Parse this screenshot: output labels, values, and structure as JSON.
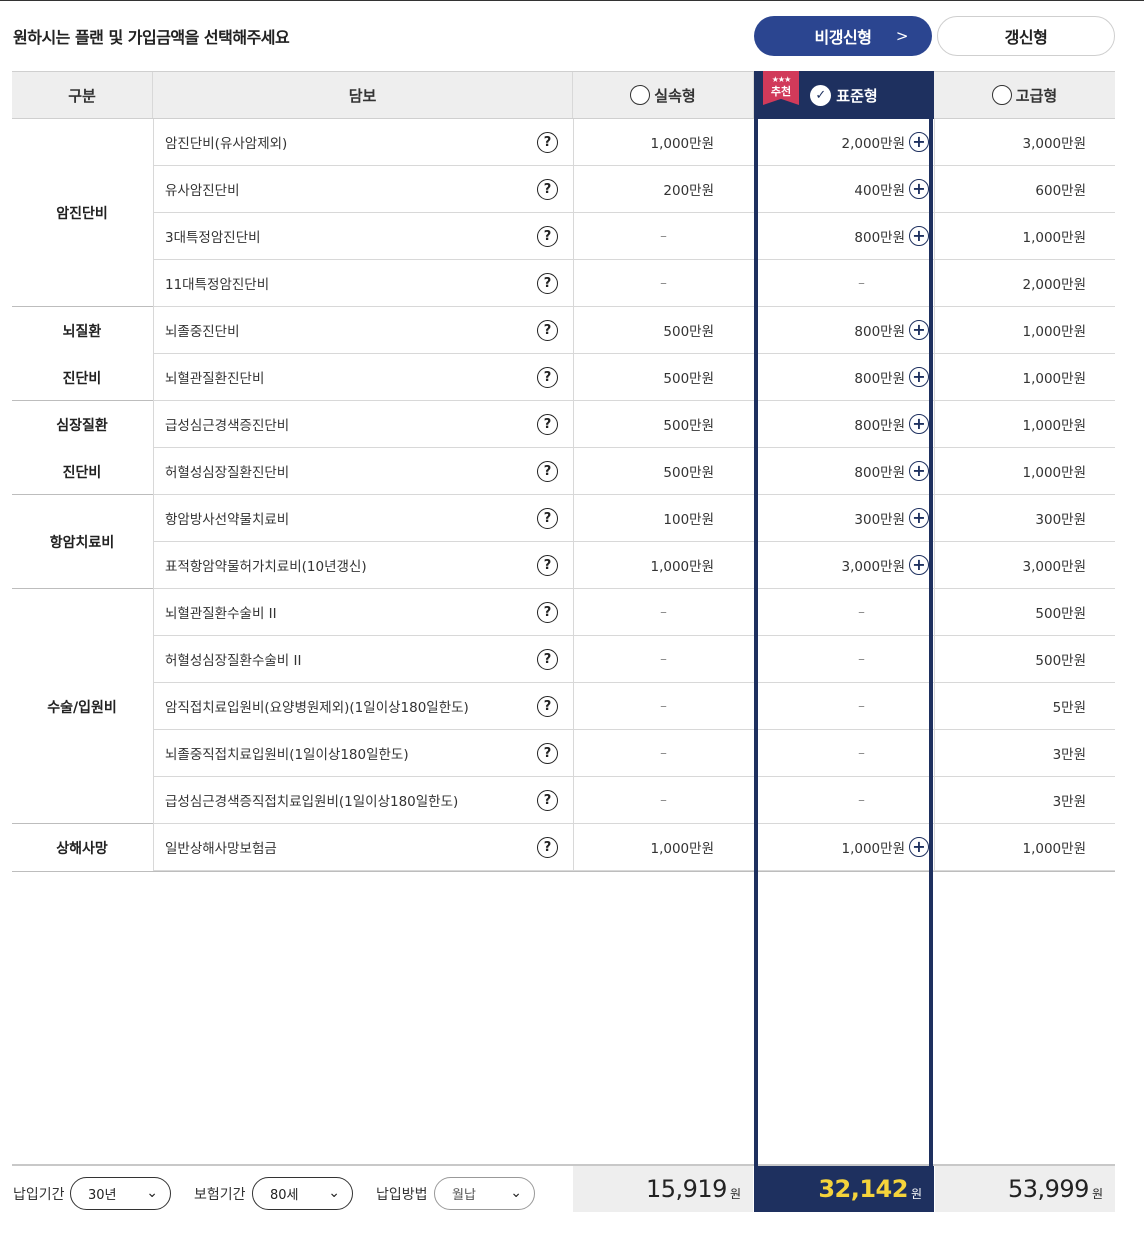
{
  "title": "원하시는 플랜 및 가입금액을 선택해주세요",
  "tabs": {
    "active_label": "비갱신형",
    "active_chevron": ">",
    "inactive_label": "갱신형"
  },
  "header": {
    "category": "구분",
    "coverage": "담보",
    "plan1": "실속형",
    "plan2": "표준형",
    "plan3": "고급형",
    "badge_stars": "★★★",
    "badge_text": "추천"
  },
  "categories": [
    {
      "lines": [
        "암진단비"
      ]
    },
    {
      "lines": [
        "뇌질환",
        "진단비"
      ]
    },
    {
      "lines": [
        "심장질환",
        "진단비"
      ]
    },
    {
      "lines": [
        "항암치료비"
      ]
    },
    {
      "lines": [
        "수술/입원비"
      ]
    },
    {
      "lines": [
        "상해사망"
      ]
    }
  ],
  "rows": [
    {
      "name": "암진단비(유사암제외)",
      "v1": "1,000만원",
      "v2": "2,000만원",
      "v3": "3,000만원"
    },
    {
      "name": "유사암진단비",
      "v1": "200만원",
      "v2": "400만원",
      "v3": "600만원"
    },
    {
      "name": "3대특정암진단비",
      "v1": "–",
      "v2": "800만원",
      "v3": "1,000만원"
    },
    {
      "name": "11대특정암진단비",
      "v1": "–",
      "v2": "–",
      "v3": "2,000만원"
    },
    {
      "name": "뇌졸중진단비",
      "v1": "500만원",
      "v2": "800만원",
      "v3": "1,000만원"
    },
    {
      "name": "뇌혈관질환진단비",
      "v1": "500만원",
      "v2": "800만원",
      "v3": "1,000만원"
    },
    {
      "name": "급성심근경색증진단비",
      "v1": "500만원",
      "v2": "800만원",
      "v3": "1,000만원"
    },
    {
      "name": "허혈성심장질환진단비",
      "v1": "500만원",
      "v2": "800만원",
      "v3": "1,000만원"
    },
    {
      "name": "항암방사선약물치료비",
      "v1": "100만원",
      "v2": "300만원",
      "v3": "300만원"
    },
    {
      "name": "표적항암약물허가치료비(10년갱신)",
      "v1": "1,000만원",
      "v2": "3,000만원",
      "v3": "3,000만원"
    },
    {
      "name": "뇌혈관질환수술비 II",
      "v1": "–",
      "v2": "–",
      "v3": "500만원"
    },
    {
      "name": "허혈성심장질환수술비 II",
      "v1": "–",
      "v2": "–",
      "v3": "500만원"
    },
    {
      "name": "암직접치료입원비(요양병원제외)(1일이상180일한도)",
      "v1": "–",
      "v2": "–",
      "v3": "5만원"
    },
    {
      "name": "뇌졸중직접치료입원비(1일이상180일한도)",
      "v1": "–",
      "v2": "–",
      "v3": "3만원"
    },
    {
      "name": "급성심근경색증직접치료입원비(1일이상180일한도)",
      "v1": "–",
      "v2": "–",
      "v3": "3만원"
    },
    {
      "name": "일반상해사망보험금",
      "v1": "1,000만원",
      "v2": "1,000만원",
      "v3": "1,000만원"
    }
  ],
  "qmark": "?",
  "plus": "+",
  "footer": {
    "pay_period_label": "납입기간",
    "pay_period_value": "30년",
    "ins_period_label": "보험기간",
    "ins_period_value": "80세",
    "pay_method_label": "납입방법",
    "pay_method_value": "월납",
    "arrow": "⌄"
  },
  "prices": {
    "p1": "15,919",
    "p2": "32,142",
    "p3": "53,999",
    "unit": "원"
  },
  "colors": {
    "navy": "#1e305f",
    "tab_blue": "#2b4590",
    "price_highlight": "#f5d33b",
    "badge": "#d13a5a"
  }
}
